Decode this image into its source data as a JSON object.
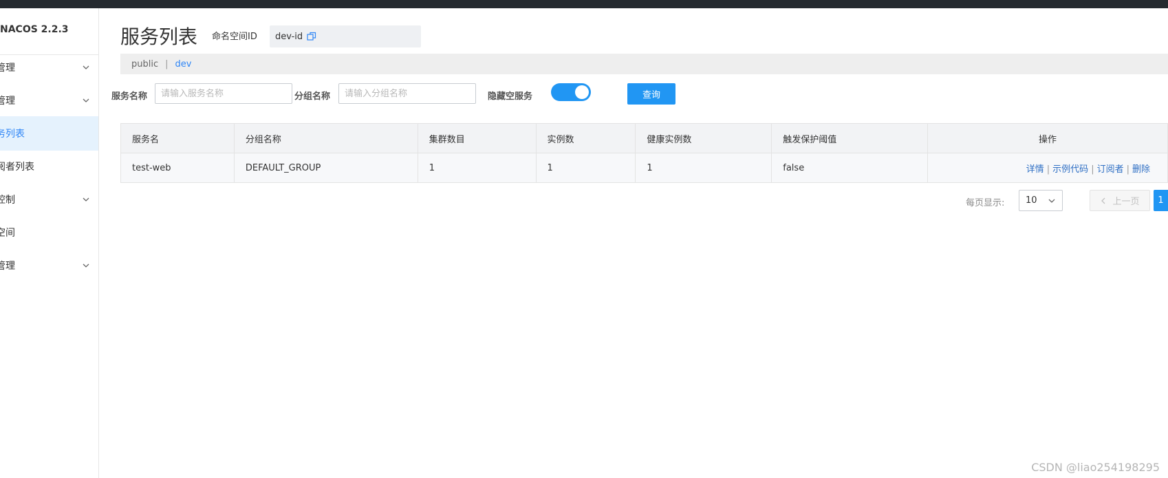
{
  "app": {
    "brand": "NACOS 2.2.3"
  },
  "sidebar": {
    "items": [
      {
        "label": "管理",
        "expandable": true,
        "active": false
      },
      {
        "label": "管理",
        "expandable": true,
        "active": false
      },
      {
        "label": "务列表",
        "expandable": false,
        "active": true
      },
      {
        "label": "阅者列表",
        "expandable": false,
        "active": false
      },
      {
        "label": "控制",
        "expandable": true,
        "active": false
      },
      {
        "label": "空间",
        "expandable": false,
        "active": false
      },
      {
        "label": "管理",
        "expandable": true,
        "active": false
      }
    ]
  },
  "header": {
    "title": "服务列表",
    "namespace_label": "命名空间ID",
    "namespace_value": "dev-id"
  },
  "namespace_tabs": {
    "items": [
      {
        "label": "public",
        "active": false
      },
      {
        "label": "dev",
        "active": true
      }
    ],
    "separator": "|"
  },
  "filters": {
    "service_name_label": "服务名称",
    "service_name_placeholder": "请输入服务名称",
    "service_name_value": "",
    "group_name_label": "分组名称",
    "group_name_placeholder": "请输入分组名称",
    "group_name_value": "",
    "hide_empty_label": "隐藏空服务",
    "hide_empty_on": true,
    "query_button": "查询"
  },
  "table": {
    "columns": [
      "服务名",
      "分组名称",
      "集群数目",
      "实例数",
      "健康实例数",
      "触发保护阈值",
      "操作"
    ],
    "rows": [
      {
        "service": "test-web",
        "group": "DEFAULT_GROUP",
        "clusters": "1",
        "instances": "1",
        "healthy": "1",
        "threshold": "false",
        "actions": [
          "详情",
          "示例代码",
          "订阅者",
          "删除"
        ]
      }
    ],
    "action_separator": "|"
  },
  "pagination": {
    "page_size_label": "每页显示:",
    "page_size": "10",
    "prev_label": "上一页",
    "current_page": "1"
  },
  "watermark": "CSDN @liao254198295",
  "colors": {
    "accent": "#2196f3",
    "link": "#2f6fc4",
    "active_nav_bg": "#e5f2fd",
    "topbar": "#252a2f"
  }
}
